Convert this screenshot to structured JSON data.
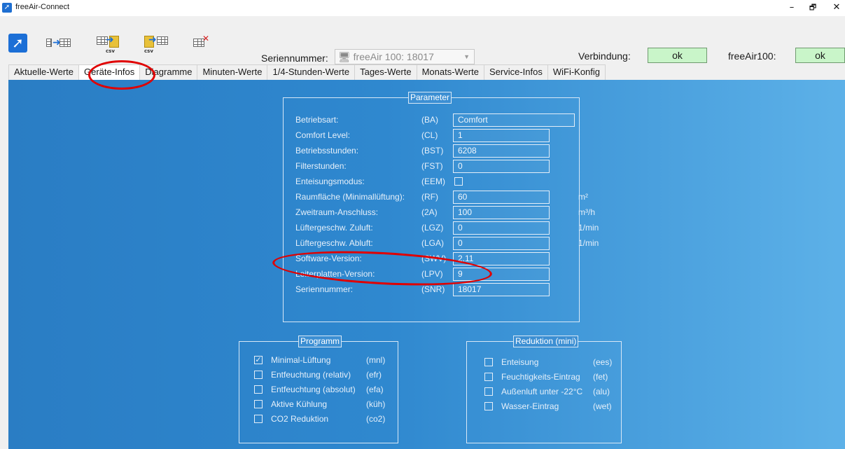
{
  "window": {
    "title": "freeAir-Connect",
    "minimize": "–",
    "restore": "🗗",
    "close": "✕"
  },
  "toolbar": {
    "icons": [
      "freeair-logo-icon",
      "read-data-icon",
      "export-csv-icon",
      "import-csv-icon",
      "delete-data-icon"
    ],
    "csv_label": "csv",
    "serial_label": "Seriennummer:",
    "serial_value": "freeAir 100: 18017",
    "connection_label": "Verbindung:",
    "connection_status": "ok",
    "device_label": "freeAir100:",
    "device_status": "ok",
    "status_color": "#c9f5c9"
  },
  "tabs": [
    {
      "label": "Aktuelle-Werte",
      "active": false
    },
    {
      "label": "Geräte-Infos",
      "active": true
    },
    {
      "label": "Diagramme",
      "active": false
    },
    {
      "label": "Minuten-Werte",
      "active": false
    },
    {
      "label": "1/4-Stunden-Werte",
      "active": false
    },
    {
      "label": "Tages-Werte",
      "active": false
    },
    {
      "label": "Monats-Werte",
      "active": false
    },
    {
      "label": "Service-Infos",
      "active": false
    },
    {
      "label": "WiFi-Konfig",
      "active": false
    }
  ],
  "parameter": {
    "title": "Parameter",
    "rows": [
      {
        "name": "Betriebsart:",
        "code": "(BA)",
        "value": "Comfort",
        "unit": ""
      },
      {
        "name": "Comfort Level:",
        "code": "(CL)",
        "value": "1",
        "unit": ""
      },
      {
        "name": "Betriebsstunden:",
        "code": "(BST)",
        "value": "6208",
        "unit": ""
      },
      {
        "name": "Filterstunden:",
        "code": "(FST)",
        "value": "0",
        "unit": ""
      },
      {
        "name": "Enteisungsmodus:",
        "code": "(EEM)",
        "value": "",
        "unit": "",
        "checkbox": true,
        "checked": false
      },
      {
        "name": "Raumfläche (Minimallüftung):",
        "code": "(RF)",
        "value": "60",
        "unit": "m²"
      },
      {
        "name": "Zweitraum-Anschluss:",
        "code": "(2A)",
        "value": "100",
        "unit": "m³/h"
      },
      {
        "name": "Lüftergeschw. Zuluft:",
        "code": "(LGZ)",
        "value": "0",
        "unit": "1/min"
      },
      {
        "name": "Lüftergeschw. Abluft:",
        "code": "(LGA)",
        "value": "0",
        "unit": "1/min"
      },
      {
        "name": "Software-Version:",
        "code": "(SWV)",
        "value": "2.11",
        "unit": ""
      },
      {
        "name": "Leiterplatten-Version:",
        "code": "(LPV)",
        "value": "9",
        "unit": ""
      },
      {
        "name": "Seriennummer:",
        "code": "(SNR)",
        "value": "18017",
        "unit": ""
      }
    ]
  },
  "programm": {
    "title": "Programm",
    "items": [
      {
        "label": "Minimal-Lüftung",
        "code": "(mnl)",
        "checked": true
      },
      {
        "label": "Entfeuchtung (relativ)",
        "code": "(efr)",
        "checked": false
      },
      {
        "label": "Entfeuchtung (absolut)",
        "code": "(efa)",
        "checked": false
      },
      {
        "label": "Aktive Kühlung",
        "code": "(küh)",
        "checked": false
      },
      {
        "label": "CO2 Reduktion",
        "code": "(co2)",
        "checked": false
      }
    ]
  },
  "reduktion": {
    "title": "Reduktion (mini)",
    "items": [
      {
        "label": "Enteisung",
        "code": "(ees)",
        "checked": false
      },
      {
        "label": "Feuchtigkeits-Eintrag",
        "code": "(fet)",
        "checked": false
      },
      {
        "label": "Außenluft unter -22°C",
        "code": "(alu)",
        "checked": false
      },
      {
        "label": "Wasser-Eintrag",
        "code": "(wet)",
        "checked": false
      }
    ]
  },
  "check_mark": "☑",
  "highlight_color": "#e00000"
}
